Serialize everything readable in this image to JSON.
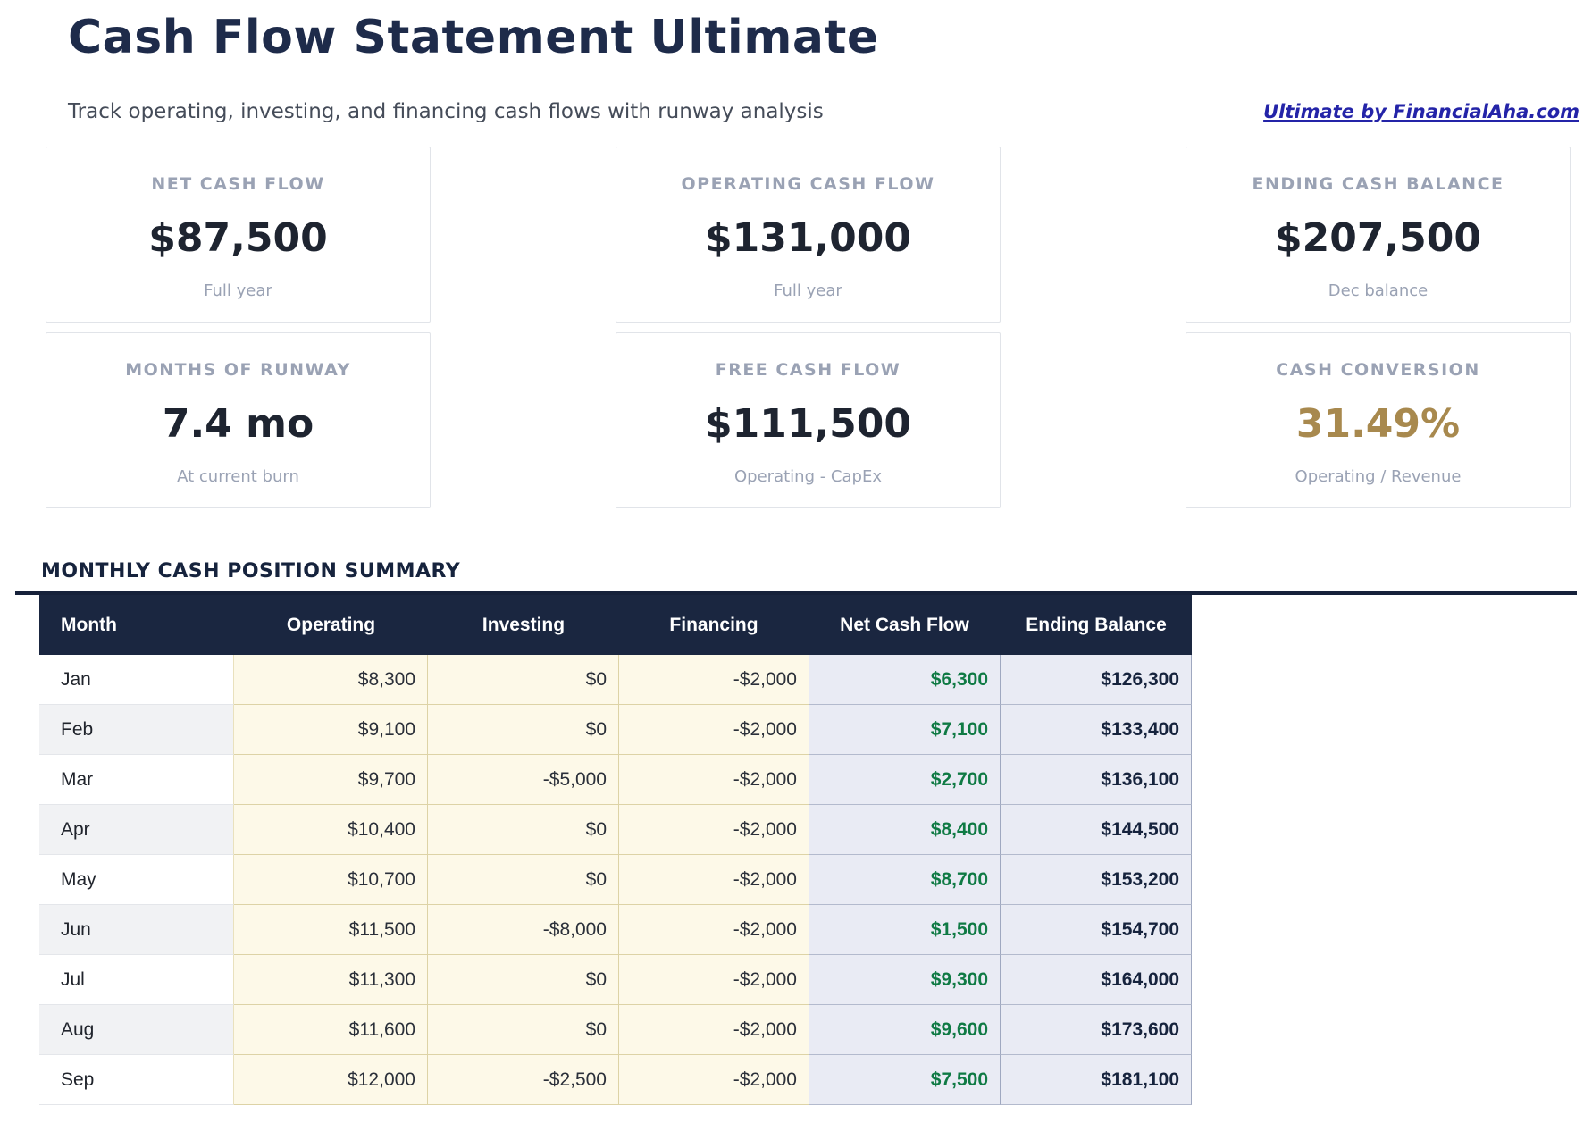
{
  "page": {
    "title": "Cash Flow Statement Ultimate",
    "subtitle": "Track operating, investing, and financing cash flows with runway analysis",
    "link": "Ultimate by FinancialAha.com"
  },
  "kpis": [
    {
      "label": "NET CASH FLOW",
      "value": "$87,500",
      "sub": "Full year",
      "value_color": "dark"
    },
    {
      "label": "OPERATING CASH FLOW",
      "value": "$131,000",
      "sub": "Full year",
      "value_color": "dark"
    },
    {
      "label": "ENDING CASH BALANCE",
      "value": "$207,500",
      "sub": "Dec balance",
      "value_color": "dark"
    },
    {
      "label": "MONTHS OF RUNWAY",
      "value": "7.4 mo",
      "sub": "At current burn",
      "value_color": "dark"
    },
    {
      "label": "FREE CASH FLOW",
      "value": "$111,500",
      "sub": "Operating - CapEx",
      "value_color": "dark"
    },
    {
      "label": "CASH CONVERSION",
      "value": "31.49%",
      "sub": "Operating / Revenue",
      "value_color": "gold"
    }
  ],
  "table": {
    "section_title": "MONTHLY CASH POSITION SUMMARY",
    "columns": [
      "Month",
      "Operating",
      "Investing",
      "Financing",
      "Net Cash Flow",
      "Ending Balance"
    ],
    "rows": [
      {
        "month": "Jan",
        "operating": "$8,300",
        "investing": "$0",
        "financing": "-$2,000",
        "net_cash_flow": "$6,300",
        "ending_balance": "$126,300"
      },
      {
        "month": "Feb",
        "operating": "$9,100",
        "investing": "$0",
        "financing": "-$2,000",
        "net_cash_flow": "$7,100",
        "ending_balance": "$133,400"
      },
      {
        "month": "Mar",
        "operating": "$9,700",
        "investing": "-$5,000",
        "financing": "-$2,000",
        "net_cash_flow": "$2,700",
        "ending_balance": "$136,100"
      },
      {
        "month": "Apr",
        "operating": "$10,400",
        "investing": "$0",
        "financing": "-$2,000",
        "net_cash_flow": "$8,400",
        "ending_balance": "$144,500"
      },
      {
        "month": "May",
        "operating": "$10,700",
        "investing": "$0",
        "financing": "-$2,000",
        "net_cash_flow": "$8,700",
        "ending_balance": "$153,200"
      },
      {
        "month": "Jun",
        "operating": "$11,500",
        "investing": "-$8,000",
        "financing": "-$2,000",
        "net_cash_flow": "$1,500",
        "ending_balance": "$154,700"
      },
      {
        "month": "Jul",
        "operating": "$11,300",
        "investing": "$0",
        "financing": "-$2,000",
        "net_cash_flow": "$9,300",
        "ending_balance": "$164,000"
      },
      {
        "month": "Aug",
        "operating": "$11,600",
        "investing": "$0",
        "financing": "-$2,000",
        "net_cash_flow": "$9,600",
        "ending_balance": "$173,600"
      },
      {
        "month": "Sep",
        "operating": "$12,000",
        "investing": "-$2,500",
        "financing": "-$2,000",
        "net_cash_flow": "$7,500",
        "ending_balance": "$181,100"
      }
    ]
  },
  "colors": {
    "navy_heading": "#1e2b4a",
    "header_bg": "#1a2640",
    "rule": "#16213a",
    "gold": "#a8894e",
    "green": "#0f7a44",
    "navy_value": "#16233d",
    "muted_label": "#9aa2b4",
    "cream_bg": "#fdf9e8",
    "cream_border": "#ddd3a6",
    "lavender_bg": "#e9ebf4",
    "lavender_border": "#9fa8c0",
    "link_blue": "#2424a8"
  }
}
